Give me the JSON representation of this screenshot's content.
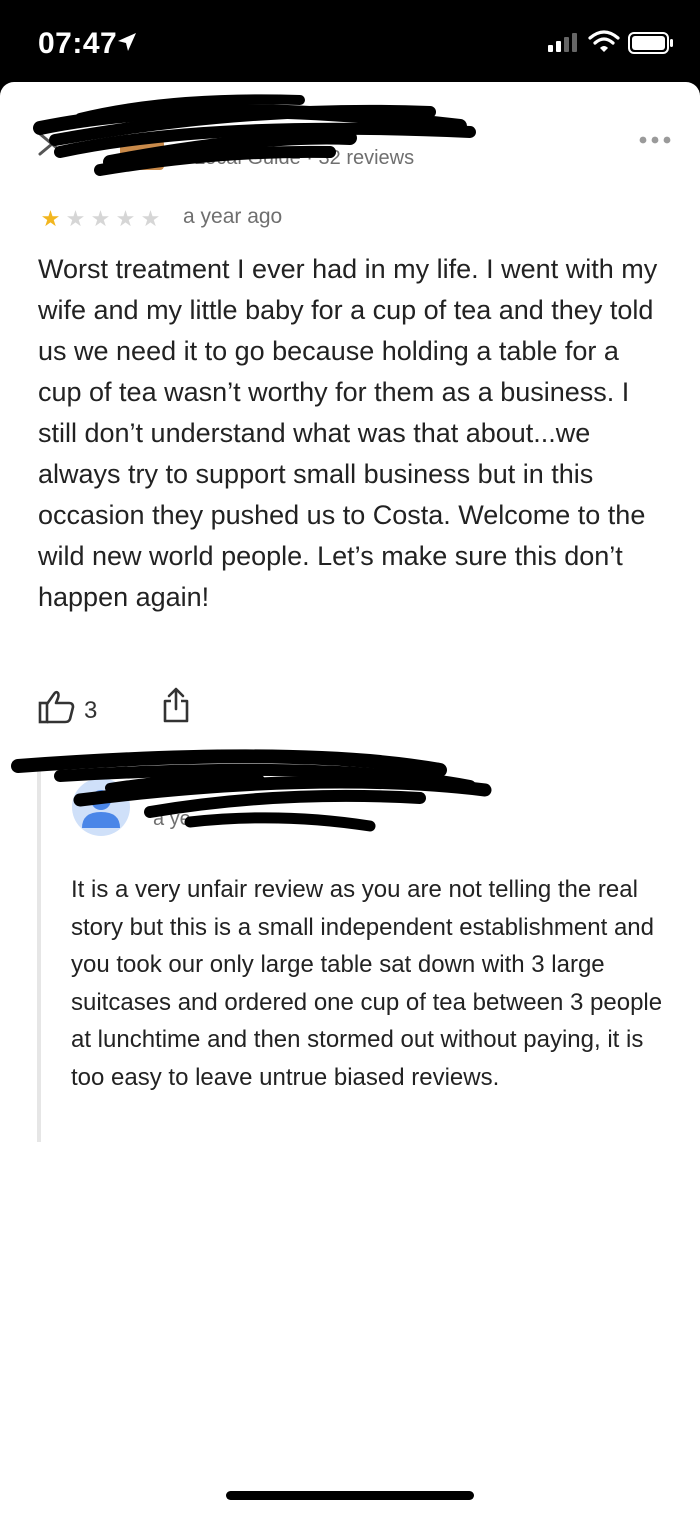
{
  "status_bar": {
    "time": "07:47"
  },
  "review": {
    "reviewer_meta": "Local Guide · 32 reviews",
    "rating": 1,
    "max_rating": 5,
    "time_ago": "a year ago",
    "text": "Worst treatment I ever had in my life. I went with my wife and my little baby for a cup of tea and they told us we need it to go because holding a table for a cup of tea wasn’t worthy for them as a business. I still don’t understand what was that about...we always try to support small business but in this occasion they pushed us to Costa. Welcome to the wild new world people. Let’s make sure this don’t happen again!",
    "likes": "3"
  },
  "owner_reply": {
    "date_fragment": "a ye",
    "text": "It is a very unfair review as you are not telling the real story but this is a small independent establishment and you took our only large table sat down with 3 large suitcases and ordered one cup of tea between 3 people at lunchtime and then stormed out without paying, it is too easy to leave untrue biased reviews."
  },
  "colors": {
    "star_filled": "#f2b61f",
    "star_empty": "#d6d6d6",
    "owner_avatar_bg": "#cfe0f9",
    "owner_avatar_fg": "#4a86e8"
  }
}
